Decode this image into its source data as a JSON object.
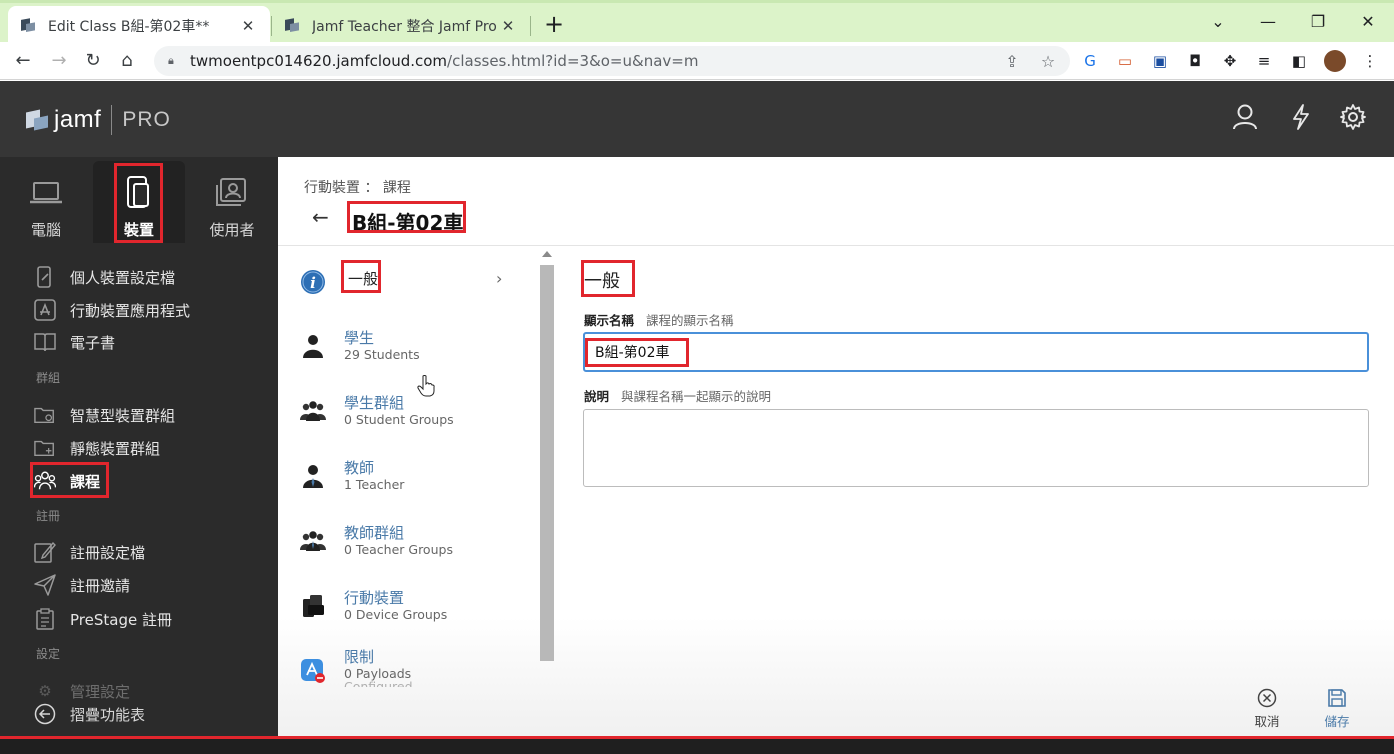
{
  "browser": {
    "tabs": [
      {
        "title": "Edit Class B組-第02車**",
        "active": true
      },
      {
        "title": "Jamf Teacher 整合 Jamf Pro - Jamf",
        "active": false
      }
    ],
    "url_host": "twmoentpc014620.jamfcloud.com",
    "url_path": "/classes.html?id=3&o=u&nav=m"
  },
  "app": {
    "logo_text": "jamf",
    "logo_suffix": "PRO"
  },
  "sidebar": {
    "top_tabs": [
      {
        "label": "電腦",
        "icon": "laptop-icon",
        "active": false
      },
      {
        "label": "裝置",
        "icon": "mobile-device-icon",
        "active": true
      },
      {
        "label": "使用者",
        "icon": "user-card-icon",
        "active": false
      }
    ],
    "items": [
      {
        "label": "個人裝置設定檔",
        "icon": "personal-device-profile-icon"
      },
      {
        "label": "行動裝置應用程式",
        "icon": "app-store-icon"
      },
      {
        "label": "電子書",
        "icon": "book-icon"
      },
      {
        "section": "群組"
      },
      {
        "label": "智慧型裝置群組",
        "icon": "smart-group-folder-icon"
      },
      {
        "label": "靜態裝置群組",
        "icon": "static-group-folder-icon"
      },
      {
        "label": "課程",
        "icon": "classes-icon",
        "active": true
      },
      {
        "section": "註冊"
      },
      {
        "label": "註冊設定檔",
        "icon": "enrollment-profile-icon"
      },
      {
        "label": "註冊邀請",
        "icon": "send-invitation-icon"
      },
      {
        "label": "PreStage 註冊",
        "icon": "prestage-clipboard-icon"
      },
      {
        "section": "設定"
      },
      {
        "label": "管理設定",
        "icon": "gear-icon"
      }
    ],
    "collapse_label": "摺疊功能表"
  },
  "main": {
    "breadcrumb": "行動裝置 ： 課程",
    "title": "B組-第02車",
    "panels": [
      {
        "title": "一般",
        "subtitle": "",
        "icon": "info-icon"
      },
      {
        "title": "學生",
        "subtitle": "29 Students",
        "icon": "student-icon"
      },
      {
        "title": "學生群組",
        "subtitle": "0 Student Groups",
        "icon": "student-group-icon"
      },
      {
        "title": "教師",
        "subtitle": "1 Teacher",
        "icon": "teacher-icon"
      },
      {
        "title": "教師群組",
        "subtitle": "0 Teacher Groups",
        "icon": "teacher-group-icon"
      },
      {
        "title": "行動裝置",
        "subtitle": "0 Device Groups",
        "icon": "mobile-devices-icon"
      },
      {
        "title": "限制",
        "subtitle": "0 Payloads",
        "subtitle2": "Configured",
        "icon": "restrictions-icon"
      }
    ],
    "section_title": "一般",
    "display_name_label": "顯示名稱",
    "display_name_help": "課程的顯示名稱",
    "display_name_value": "B組-第02車",
    "description_label": "說明",
    "description_help": "與課程名稱一起顯示的說明",
    "description_value": "",
    "cancel_label": "取消",
    "save_label": "儲存"
  },
  "colors": {
    "highlight_red": "#e1262d",
    "link_blue": "#4a7aa8",
    "sidebar_bg": "#2b2b2b",
    "header_bg": "#363636",
    "input_focus": "#4a90d9"
  }
}
